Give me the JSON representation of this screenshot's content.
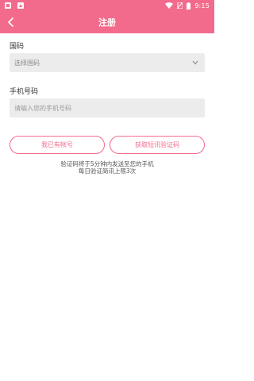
{
  "status_bar": {
    "time": "9:15",
    "icons": [
      "notification-icon",
      "app-icon",
      "wifi-icon",
      "no-sim-icon",
      "battery-icon"
    ]
  },
  "header": {
    "title": "注册",
    "back_icon": "back-arrow-icon"
  },
  "form": {
    "country_label": "国码",
    "country_select_value": "选择国码",
    "phone_label": "手机号码",
    "phone_placeholder": "请输入您的手机号码"
  },
  "buttons": {
    "have_account": "我已有帐号",
    "get_code": "获取短讯验证码"
  },
  "hints": {
    "line1": "验证码将于5分钟内发送至您的手机",
    "line2": "每日验证简讯上限3次"
  },
  "colors": {
    "accent": "#f26b8d",
    "field_bg": "#ececec"
  }
}
